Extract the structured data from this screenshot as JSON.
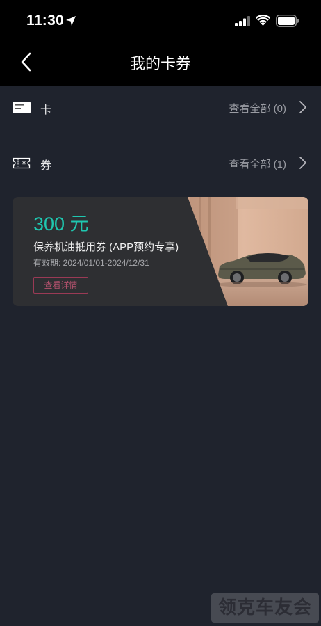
{
  "status_bar": {
    "time": "11:30"
  },
  "nav": {
    "title": "我的卡券"
  },
  "rows": [
    {
      "label": "卡",
      "link": "查看全部 (0)",
      "icon": "card-icon"
    },
    {
      "label": "券",
      "link": "查看全部 (1)",
      "icon": "ticket-icon"
    }
  ],
  "coupon": {
    "amount": "300 元",
    "name": "保养机油抵用券 (APP预约专享)",
    "validity": "有效期: 2024/01/01-2024/12/31",
    "button": "查看详情",
    "accent_color": "#1fc7b0"
  },
  "watermark": "领克车友会"
}
